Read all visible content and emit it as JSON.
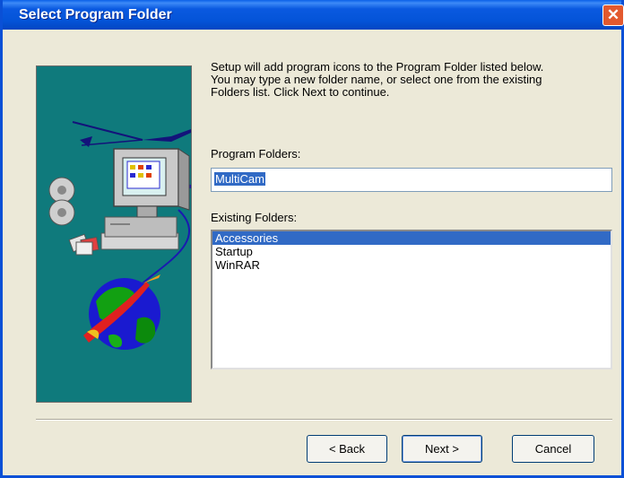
{
  "window": {
    "title": "Select Program Folder",
    "close_symbol": "✕"
  },
  "description": "Setup will add program icons to the Program Folder listed below.\nYou may type a new folder name, or select one from the existing\nFolders list.  Click Next to continue.",
  "program_folders": {
    "label": "Program Folders:",
    "value": "MultiCam"
  },
  "existing_folders": {
    "label": "Existing Folders:",
    "items": [
      "Accessories",
      "Startup",
      "WinRAR"
    ],
    "selected": "Accessories"
  },
  "buttons": {
    "back": "< Back",
    "next": "Next >",
    "cancel": "Cancel"
  },
  "colors": {
    "titlebar": "#0454d8",
    "selection": "#316ac5",
    "art_bg": "#0f7a7c"
  }
}
